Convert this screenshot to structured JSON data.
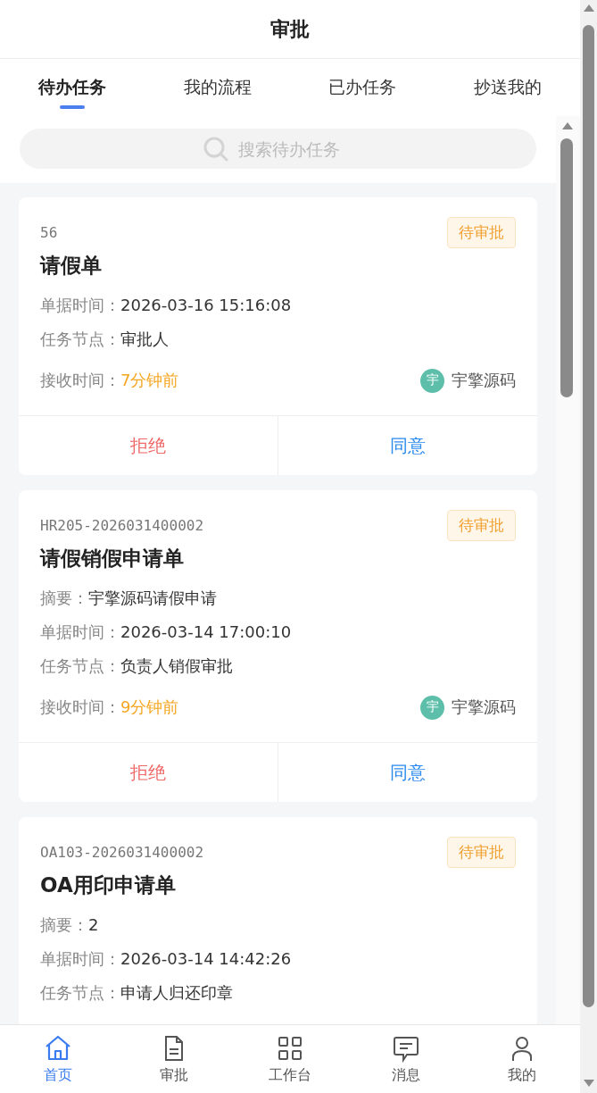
{
  "header": {
    "title": "审批"
  },
  "tabs": [
    {
      "label": "待办任务",
      "selected": true
    },
    {
      "label": "我的流程",
      "selected": false
    },
    {
      "label": "已办任务",
      "selected": false
    },
    {
      "label": "抄送我的",
      "selected": false
    }
  ],
  "search": {
    "placeholder": "搜索待办任务"
  },
  "tasks": [
    {
      "code": "56",
      "status": "待审批",
      "title": "请假单",
      "fields": [
        {
          "label": "单据时间：",
          "value": "2026-03-16 15:16:08"
        },
        {
          "label": "任务节点：",
          "value": "审批人"
        }
      ],
      "received_label": "接收时间：",
      "received": "7分钟前",
      "avatar": "宇",
      "assignee": "宇擎源码",
      "actions": [
        {
          "label": "拒绝",
          "kind": "reject"
        },
        {
          "label": "同意",
          "kind": "approve"
        }
      ]
    },
    {
      "code": "HR205-2026031400002",
      "status": "待审批",
      "title": "请假销假申请单",
      "fields": [
        {
          "label": "摘要：",
          "value": "宇擎源码请假申请"
        },
        {
          "label": "单据时间：",
          "value": "2026-03-14 17:00:10"
        },
        {
          "label": "任务节点：",
          "value": "负责人销假审批"
        }
      ],
      "received_label": "接收时间：",
      "received": "9分钟前",
      "avatar": "宇",
      "assignee": "宇擎源码",
      "actions": [
        {
          "label": "拒绝",
          "kind": "reject"
        },
        {
          "label": "同意",
          "kind": "approve"
        }
      ]
    },
    {
      "code": "OA103-2026031400002",
      "status": "待审批",
      "title": "OA用印申请单",
      "fields": [
        {
          "label": "摘要：",
          "value": "2"
        },
        {
          "label": "单据时间：",
          "value": "2026-03-14 14:42:26"
        },
        {
          "label": "任务节点：",
          "value": "申请人归还印章"
        }
      ]
    }
  ],
  "nav": [
    {
      "label": "首页",
      "kind": "home",
      "selected": true
    },
    {
      "label": "审批",
      "kind": "doc",
      "selected": false
    },
    {
      "label": "工作台",
      "kind": "grid",
      "selected": false
    },
    {
      "label": "消息",
      "kind": "chat",
      "selected": false
    },
    {
      "label": "我的",
      "kind": "user",
      "selected": false
    }
  ]
}
